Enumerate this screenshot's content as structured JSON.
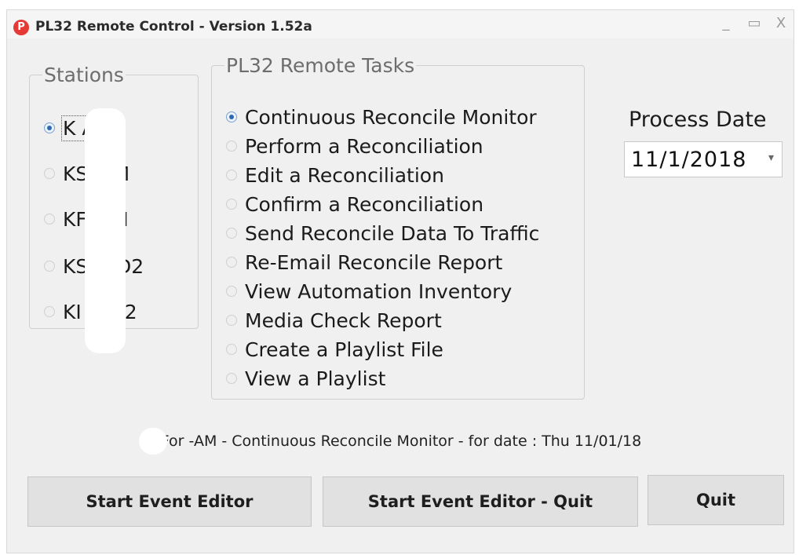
{
  "window": {
    "app_icon_letter": "P",
    "title": "PL32 Remote Control - Version 1.52a",
    "minimize_glyph": "_",
    "maximize_glyph": "▭",
    "close_glyph": "X"
  },
  "stations": {
    "legend": "Stations",
    "items": [
      {
        "label": "K AM",
        "selected": true
      },
      {
        "label": "KS -FM",
        "selected": false
      },
      {
        "label": "KF -FM",
        "selected": false
      },
      {
        "label": "KS -HD2",
        "selected": false
      },
      {
        "label": "KI -HD2",
        "selected": false
      }
    ]
  },
  "tasks": {
    "legend": "PL32 Remote Tasks",
    "items": [
      {
        "label": "Continuous Reconcile Monitor",
        "selected": true
      },
      {
        "label": "Perform a Reconciliation",
        "selected": false
      },
      {
        "label": "Edit a Reconciliation",
        "selected": false
      },
      {
        "label": "Confirm a Reconciliation",
        "selected": false
      },
      {
        "label": "Send Reconcile Data To Traffic",
        "selected": false
      },
      {
        "label": "Re-Email Reconcile Report",
        "selected": false
      },
      {
        "label": "View Automation Inventory",
        "selected": false
      },
      {
        "label": "Media Check Report",
        "selected": false
      },
      {
        "label": "Create a Playlist File",
        "selected": false
      },
      {
        "label": "View a Playlist",
        "selected": false
      }
    ]
  },
  "process_date": {
    "label": "Process Date",
    "value": "11/1/2018",
    "arrow_glyph": "▾"
  },
  "status_line": "For -AM - Continuous Reconcile Monitor - for date : Thu 11/01/18",
  "buttons": {
    "start_event_editor": "Start Event Editor",
    "start_event_editor_quit": "Start Event Editor - Quit",
    "quit": "Quit"
  },
  "colors": {
    "app_icon": "#e53935",
    "radio_selected": "#2e68b1",
    "window_bg": "#f0f0f0",
    "button_bg": "#e1e1e1"
  }
}
